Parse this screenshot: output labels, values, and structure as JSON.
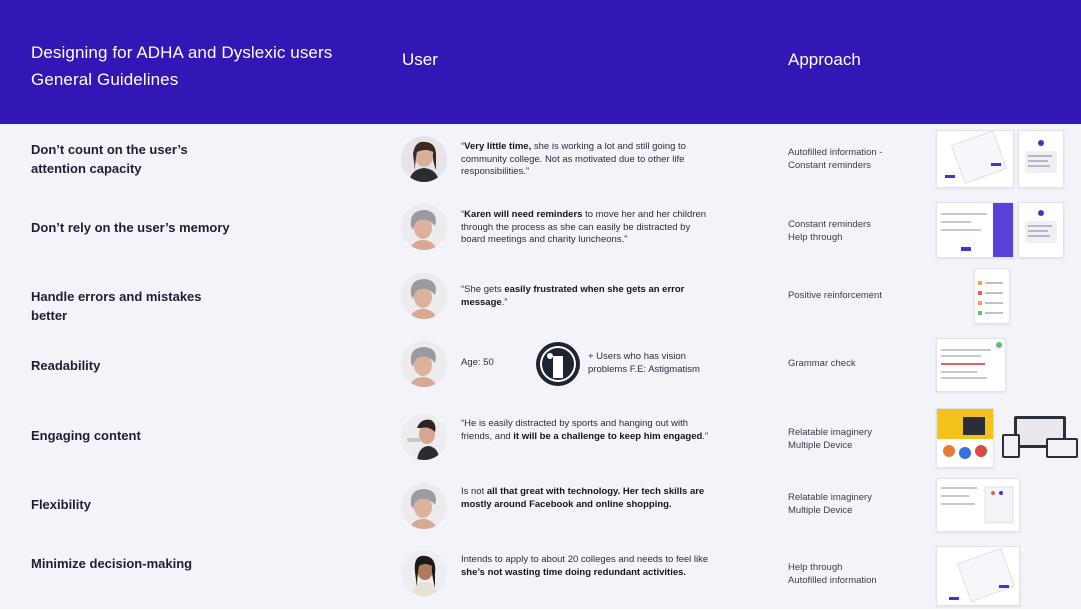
{
  "header": {
    "title_line1": "Designing for ADHA and Dyslexic users",
    "title_line2": "General Guidelines",
    "col_user": "User",
    "col_approach": "Approach"
  },
  "rows": [
    {
      "guideline_line1": "Don’t count on the user’s",
      "guideline_line2": "attention capacity",
      "quote_parts": [
        "“",
        "Very little time,",
        " she is working a lot and still going to community college. Not as motivated due to other life responsibilities.”"
      ],
      "approach_line1": "Autofilled information -",
      "approach_line2": "Constant reminders"
    },
    {
      "guideline_line1": "Don’t rely on the user’s memory",
      "guideline_line2": "",
      "quote_parts": [
        "“",
        "Karen will need reminders",
        " to move her and her children through the process as she can easily be distracted by board meetings and charity luncheons.”"
      ],
      "approach_line1": "Constant reminders",
      "approach_line2": "Help through"
    },
    {
      "guideline_line1": "Handle errors and mistakes better",
      "guideline_line2": "",
      "quote_parts": [
        "“She gets ",
        "easily frustrated when she gets an error message",
        ".”"
      ],
      "approach_line1": "Positive reinforcement",
      "approach_line2": ""
    },
    {
      "guideline_line1": "Readability",
      "guideline_line2": "",
      "age": "Age: 50",
      "extra": "+ Users who has vision problems F.E: Astigmatism",
      "approach_line1": "Grammar check",
      "approach_line2": ""
    },
    {
      "guideline_line1": "Engaging content",
      "guideline_line2": "",
      "quote_parts": [
        "“He is easily distracted by  sports and hanging out with friends, and ",
        "it will be a challenge to keep him engaged",
        ".”"
      ],
      "approach_line1": "Relatable imaginery",
      "approach_line2": "Multiple Device"
    },
    {
      "guideline_line1": "Flexibility",
      "guideline_line2": "",
      "quote_parts": [
        "Is not ",
        "all that great with technology. Her tech skills are mostly around Facebook and online shopping.",
        ""
      ],
      "approach_line1": "Relatable imaginery",
      "approach_line2": "Multiple Device"
    },
    {
      "guideline_line1": "Minimize decision-making",
      "guideline_line2": "",
      "quote_parts": [
        "Intends to apply to about 20 colleges and needs to  feel like ",
        "she’s not wasting time doing redundant activities.",
        ""
      ],
      "approach_line1": "Help through",
      "approach_line2": "Autofilled information"
    }
  ],
  "colors": {
    "header_bg": "#3216b6",
    "body_bg": "#f3f3fa",
    "accent": "#4b2fd1"
  }
}
